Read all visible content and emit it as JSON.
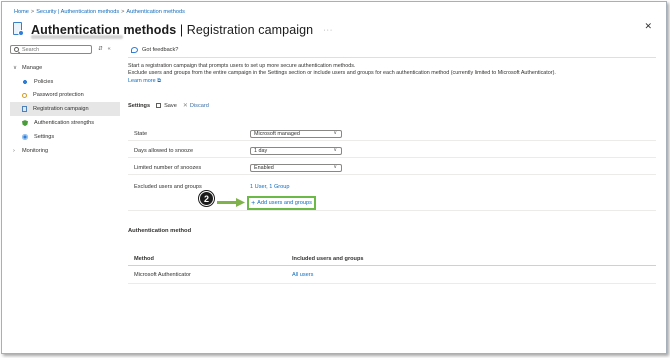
{
  "breadcrumb": [
    "Home",
    "Security | Authentication methods",
    "Authentication methods"
  ],
  "breadcrumb_separator": ">",
  "header": {
    "title_main": "Authentication methods",
    "title_rest": " | Registration campaign",
    "more": "···",
    "close": "✕"
  },
  "sidebar": {
    "search_placeholder": "Search",
    "tools": [
      "⇵",
      "«"
    ],
    "items": [
      {
        "label": "Manage",
        "chevron": "∨"
      },
      {
        "label": "Policies"
      },
      {
        "label": "Password protection"
      },
      {
        "label": "Registration campaign"
      },
      {
        "label": "Authentication strengths"
      },
      {
        "label": "Settings"
      },
      {
        "label": "Monitoring",
        "chevron": "›"
      }
    ]
  },
  "main": {
    "feedback": "Got feedback?",
    "intro_line1": "Start a registration campaign that prompts users to set up more secure authentication methods.",
    "intro_line2": "Exclude users and groups from the entire campaign in the Settings section or include users and groups for each authentication method (currently limited to Microsoft Authenticator).",
    "learn_more": "Learn more",
    "learn_more_icon": "⧉",
    "settings_label": "Settings",
    "save": "Save",
    "discard": "Discard",
    "discard_icon": "✕",
    "form": {
      "state_label": "State",
      "state_value": "Microsoft managed",
      "days_label": "Days allowed to snooze",
      "days_value": "1 day",
      "snoozes_label": "Limited number of snoozes",
      "snoozes_value": "Enabled",
      "excluded_label": "Excluded users and groups",
      "excluded_value": "1 User, 1 Group",
      "dropdown_icon": "∨"
    },
    "add_button": "Add users and groups",
    "add_icon": "+",
    "step_badge": "2",
    "auth_method_title": "Authentication method",
    "table": {
      "headers": [
        "Method",
        "Included users and groups"
      ],
      "rows": [
        {
          "method": "Microsoft Authenticator",
          "included": "All users"
        }
      ]
    }
  },
  "colors": {
    "link": "#0f6cbd",
    "highlight_green": "#6bba47",
    "arrow_green": "#7fb24a"
  }
}
